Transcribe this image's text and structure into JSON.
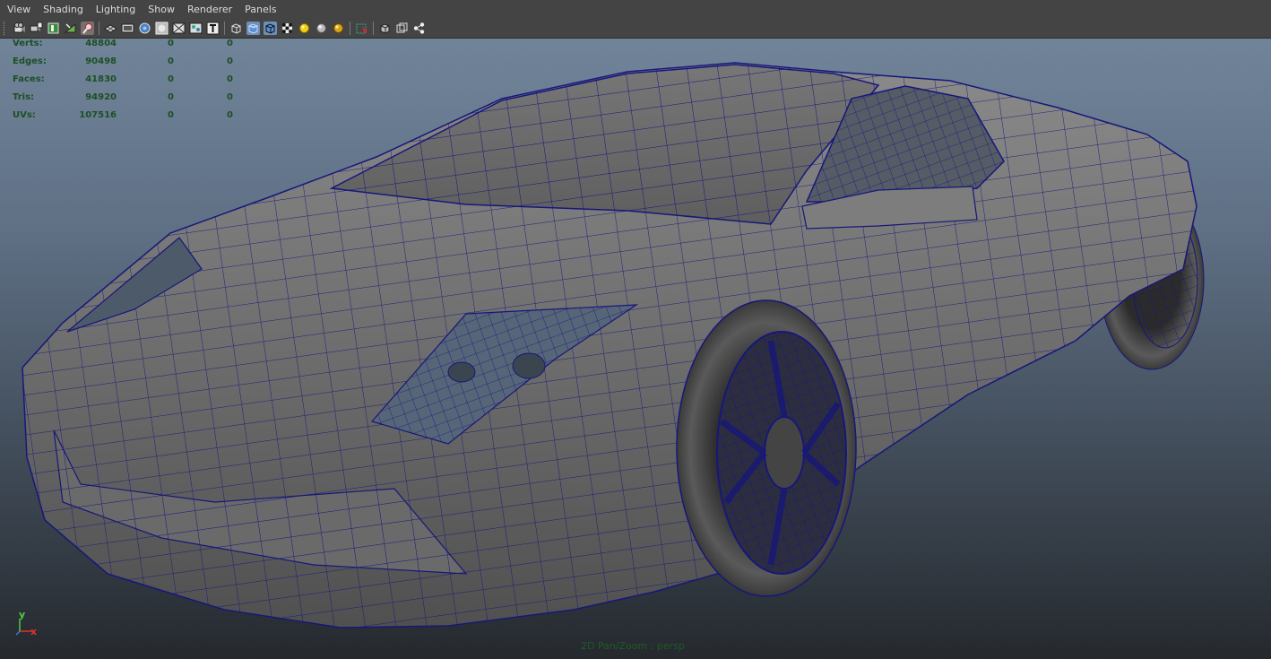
{
  "menu": [
    "View",
    "Shading",
    "Lighting",
    "Show",
    "Renderer",
    "Panels"
  ],
  "toolbar": {
    "icons": [
      "camera-attributes-icon",
      "bookmark-camera-icon",
      "image-plane-icon",
      "two-d-pan-zoom-icon",
      "grease-pencil-icon",
      "grid-icon",
      "film-gate-icon",
      "resolution-gate-icon",
      "gate-mask-icon",
      "field-chart-icon",
      "safe-action-icon",
      "safe-title-icon",
      "wireframe-icon",
      "smooth-shade-icon",
      "wireframe-on-shaded-icon",
      "texture-checker-icon",
      "use-default-light-icon",
      "shadows-icon",
      "high-quality-icon",
      "xray-icon",
      "isolate-select-icon",
      "xray-joints-icon",
      "xray-active-icon"
    ]
  },
  "hud": {
    "rows": [
      {
        "label": "Verts:",
        "v1": "48804",
        "v2": "0",
        "v3": "0"
      },
      {
        "label": "Edges:",
        "v1": "90498",
        "v2": "0",
        "v3": "0"
      },
      {
        "label": "Faces:",
        "v1": "41830",
        "v2": "0",
        "v3": "0"
      },
      {
        "label": "Tris:",
        "v1": "94920",
        "v2": "0",
        "v3": "0"
      },
      {
        "label": "UVs:",
        "v1": "107516",
        "v2": "0",
        "v3": "0"
      }
    ]
  },
  "axis": {
    "y": "y",
    "x": "x"
  },
  "status": "2D Pan/Zoom : persp",
  "colors": {
    "wire": "#17177a",
    "hud_text": "#1d4f24",
    "axis_x": "#e0302a",
    "axis_y": "#4ccc3a",
    "axis_z": "#3a6fe0"
  }
}
